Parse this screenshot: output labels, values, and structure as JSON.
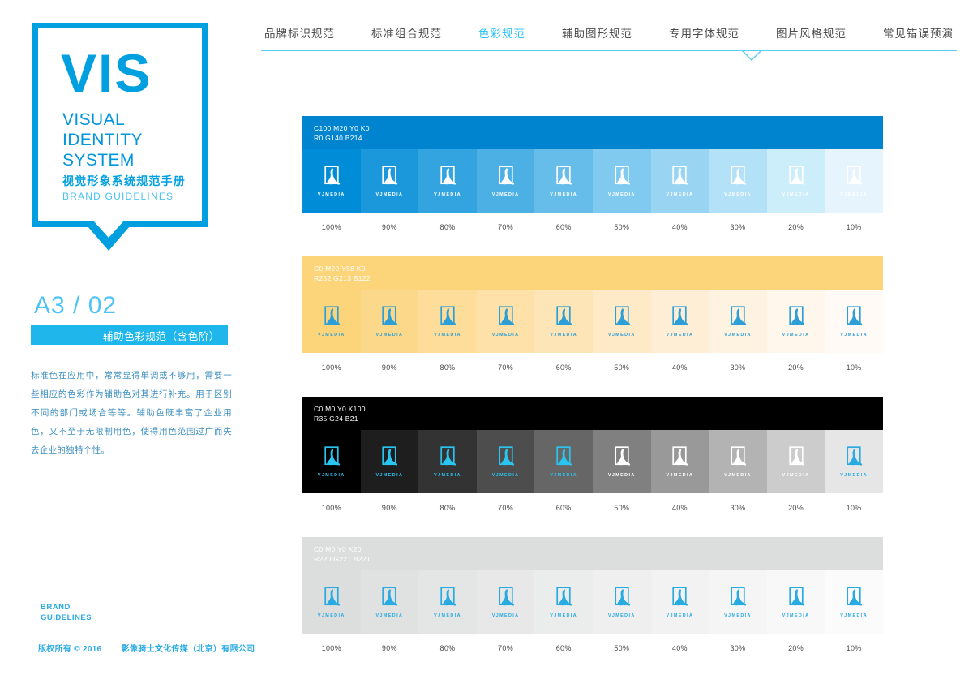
{
  "sidebar": {
    "logo": {
      "title": "VIS",
      "subtitle_lines": "VISUAL\nIDENTITY\nSYSTEM",
      "chinese": "视觉形象系统规范手册",
      "english": "BRAND  GUIDELINES"
    },
    "page_code": "A3 / 02",
    "section_title": "辅助色彩规范（含色阶）",
    "body_text": "标准色在应用中，常常显得单调或不够用，需要一些相应的色彩作为辅助色对其进行补充。用于区别不同的部门或场合等等。辅助色既丰富了企业用色，又不至于无限制用色，使得用色范围过广而失去企业的独特个性。",
    "footer_brand": "BRAND\nGUIDELINES",
    "footer_copyright_left": "版权所有  © 2016",
    "footer_copyright_right": "影像骑士文化传媒（北京）有限公司"
  },
  "topnav": {
    "items": [
      {
        "label": "品牌标识规范",
        "active": false
      },
      {
        "label": "标准组合规范",
        "active": false
      },
      {
        "label": "色彩规范",
        "active": true
      },
      {
        "label": "辅助图形规范",
        "active": false
      },
      {
        "label": "专用字体规范",
        "active": false
      },
      {
        "label": "图片风格规范",
        "active": false
      },
      {
        "label": "常见错误预演",
        "active": false
      }
    ],
    "active_index": 2,
    "underline_color": "#57CDF3",
    "active_color": "#2FC4F5"
  },
  "logo_wordmark": "VJMEDIA",
  "scale_labels": [
    "100%",
    "90%",
    "80%",
    "70%",
    "60%",
    "50%",
    "40%",
    "30%",
    "20%",
    "10%"
  ],
  "bands": [
    {
      "name": "primary-blue",
      "cmyk": "C100 M20 Y0 K0",
      "rgb": "R0 G140 B214",
      "header_bg": "#0084CF",
      "header_text_color": "#ffffff",
      "base_hex": "#008CD6",
      "tints": [
        "#008CD6",
        "#1A98DB",
        "#33A4E0",
        "#4DB0E5",
        "#66BDEA",
        "#80C9EF",
        "#99D5F3",
        "#B3E1F7",
        "#CCEDFA",
        "#E6F4FD"
      ],
      "logo_colors": [
        "#ffffff",
        "#ffffff",
        "#ffffff",
        "#ffffff",
        "#ffffff",
        "#ffffff",
        "#ffffff",
        "#ffffff",
        "#ffffff",
        "#ffffff"
      ]
    },
    {
      "name": "accent-yellow",
      "cmyk": "C0 M20 Y58 K0",
      "rgb": "R252 G213 B122",
      "header_bg": "#FCD57A",
      "header_text_color": "#ffffff",
      "base_hex": "#FCD57A",
      "tints": [
        "#FCD57A",
        "#FCD98A",
        "#FDDD99",
        "#FDE1A8",
        "#FDE5B7",
        "#FEEAC6",
        "#FEEED5",
        "#FEF2E0",
        "#FFF6EC",
        "#FFFAF5"
      ],
      "logo_colors": [
        "#2E9FD6",
        "#2E9FD6",
        "#2E9FD6",
        "#2E9FD6",
        "#2E9FD6",
        "#2E9FD6",
        "#2E9FD6",
        "#2E9FD6",
        "#2E9FD6",
        "#2E9FD6"
      ]
    },
    {
      "name": "neutral-black",
      "cmyk": "C0 M0 Y0 K100",
      "rgb": "R35 G24 B21",
      "header_bg": "#000000",
      "header_text_color": "#ffffff",
      "base_hex": "#231815",
      "tints": [
        "#000000",
        "#1E1E1E",
        "#333333",
        "#4D4D4D",
        "#666666",
        "#808080",
        "#999999",
        "#B3B3B3",
        "#CCCCCC",
        "#E6E6E6"
      ],
      "logo_colors": [
        "#29C5F0",
        "#29C5F0",
        "#29C5F0",
        "#29C5F0",
        "#29C5F0",
        "#ffffff",
        "#ffffff",
        "#ffffff",
        "#ffffff",
        "#29ABE2"
      ]
    },
    {
      "name": "neutral-gray",
      "cmyk": "C0 M0 Y0 K20",
      "rgb": "R220 G221 B221",
      "header_bg": "#DCDDDD",
      "header_text_color": "#ffffff",
      "base_hex": "#DCDDDD",
      "tints": [
        "#DCDDDD",
        "#E0E1E1",
        "#E4E5E5",
        "#E8E8E8",
        "#EBECEC",
        "#EFEFEF",
        "#F2F2F2",
        "#F5F5F5",
        "#F8F8F8",
        "#FBFBFB"
      ],
      "logo_colors": [
        "#29ABE2",
        "#29ABE2",
        "#29ABE2",
        "#29ABE2",
        "#29ABE2",
        "#29ABE2",
        "#29ABE2",
        "#29ABE2",
        "#29ABE2",
        "#29ABE2"
      ]
    }
  ]
}
